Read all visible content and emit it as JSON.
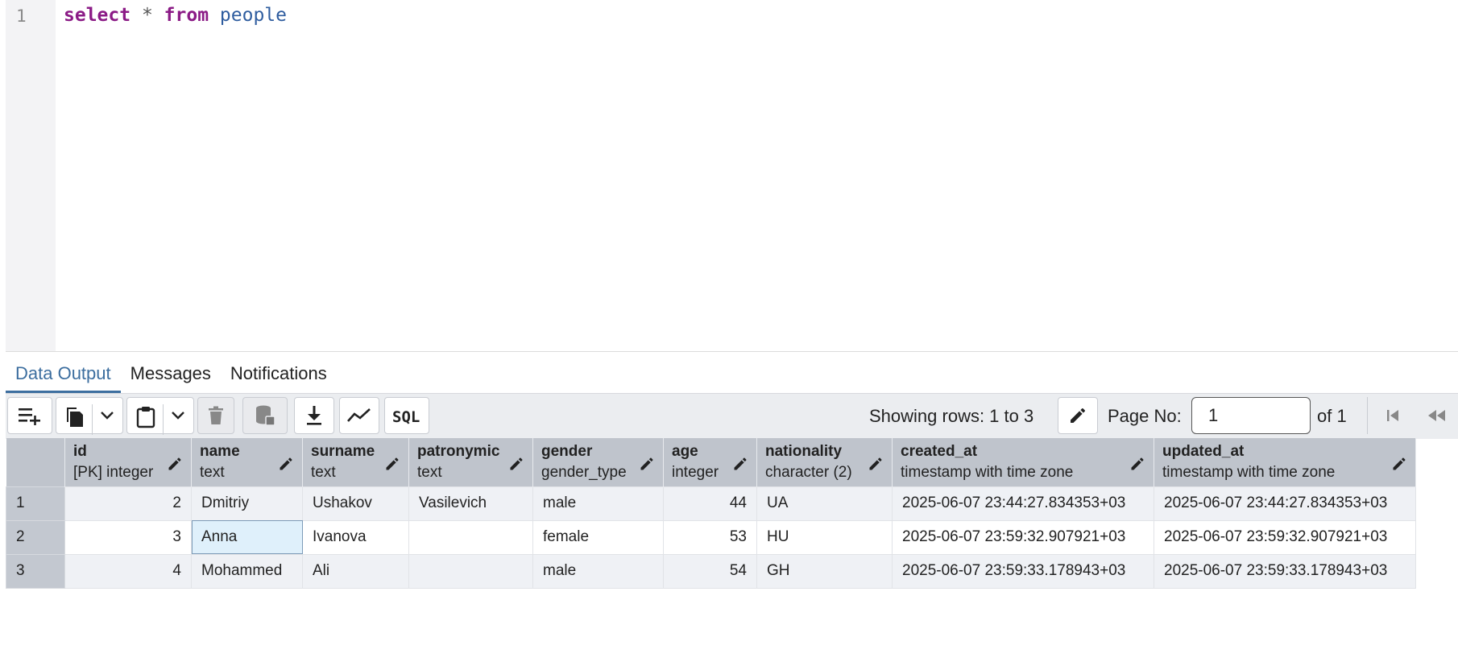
{
  "editor": {
    "line_number": "1",
    "query": {
      "kw_select": "select",
      "op_star": "*",
      "kw_from": "from",
      "table": "people"
    }
  },
  "tabs": [
    {
      "label": "Data Output",
      "active": true
    },
    {
      "label": "Messages"
    },
    {
      "label": "Notifications"
    }
  ],
  "toolbar": {
    "rows_label": "Showing rows: 1 to 3",
    "page_no_label": "Page No:",
    "page_no_value": "1",
    "of_label": "of 1",
    "icons": [
      "add-row-icon",
      "copy-icon",
      "chevron-down-icon",
      "paste-icon",
      "chevron-down-icon",
      "delete-icon",
      "save-data-icon",
      "download-icon",
      "graph-icon",
      "sql-icon",
      "edit-icon",
      "first-page-icon",
      "previous-page-icon"
    ]
  },
  "grid": {
    "columns": [
      {
        "name": "id",
        "type": "[PK] integer"
      },
      {
        "name": "name",
        "type": "text"
      },
      {
        "name": "surname",
        "type": "text"
      },
      {
        "name": "patronymic",
        "type": "text"
      },
      {
        "name": "gender",
        "type": "gender_type"
      },
      {
        "name": "age",
        "type": "integer"
      },
      {
        "name": "nationality",
        "type": "character (2)"
      },
      {
        "name": "created_at",
        "type": "timestamp with time zone"
      },
      {
        "name": "updated_at",
        "type": "timestamp with time zone"
      }
    ],
    "rows": [
      {
        "n": "1",
        "id": "2",
        "name": "Dmitriy",
        "surname": "Ushakov",
        "patronymic": "Vasilevich",
        "gender": "male",
        "age": "44",
        "nationality": "UA",
        "created_at": "2025-06-07 23:44:27.834353+03",
        "updated_at": "2025-06-07 23:44:27.834353+03"
      },
      {
        "n": "2",
        "id": "3",
        "name": "Anna",
        "surname": "Ivanova",
        "patronymic": "",
        "gender": "female",
        "age": "53",
        "nationality": "HU",
        "created_at": "2025-06-07 23:59:32.907921+03",
        "updated_at": "2025-06-07 23:59:32.907921+03"
      },
      {
        "n": "3",
        "id": "4",
        "name": "Mohammed",
        "surname": "Ali",
        "patronymic": "",
        "gender": "male",
        "age": "54",
        "nationality": "GH",
        "created_at": "2025-06-07 23:59:33.178943+03",
        "updated_at": "2025-06-07 23:59:33.178943+03"
      }
    ]
  }
}
